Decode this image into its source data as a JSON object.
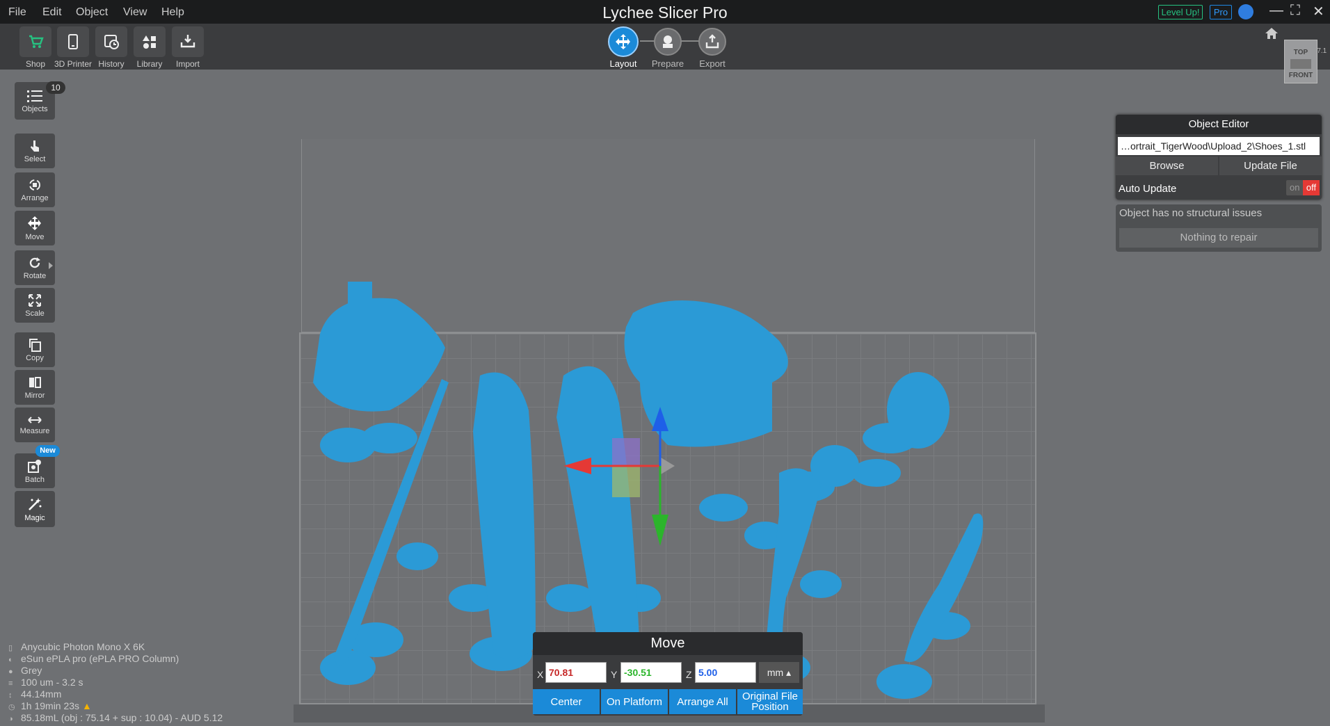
{
  "menu": [
    "File",
    "Edit",
    "Object",
    "View",
    "Help"
  ],
  "app_title": "Lychee Slicer Pro",
  "badges": {
    "level_up": "Level Up!",
    "pro": "Pro"
  },
  "toolbar": {
    "items": [
      "Shop",
      "3D Printer",
      "History",
      "Library",
      "Import"
    ]
  },
  "workflow": {
    "steps": [
      "Layout",
      "Prepare",
      "Export"
    ],
    "active": "Layout"
  },
  "version": "3.7.1",
  "viewcube": {
    "top": "TOP",
    "front": "FRONT"
  },
  "left_tools": {
    "objects": "Objects",
    "object_count": "10",
    "select": "Select",
    "arrange": "Arrange",
    "move": "Move",
    "rotate": "Rotate",
    "scale": "Scale",
    "copy": "Copy",
    "mirror": "Mirror",
    "measure": "Measure",
    "batch": "Batch",
    "batch_badge": "New",
    "magic": "Magic"
  },
  "info": {
    "printer": "Anycubic Photon Mono X 6K",
    "resin": "eSun ePLA pro (ePLA PRO Column)",
    "color": "Grey",
    "layer": "100 um - 3.2 s",
    "height": "44.14mm",
    "time": "1h 19min 23s",
    "volume": "85.18mL (obj : 75.14 + sup : 10.04) - AUD 5.12"
  },
  "object_editor": {
    "title": "Object Editor",
    "file_path": "…ortrait_TigerWood\\Upload_2\\Shoes_1.stl",
    "browse": "Browse",
    "update_file": "Update File",
    "auto_update_label": "Auto Update",
    "toggle_on": "on",
    "toggle_off": "off",
    "status": "Object has no structural issues",
    "repair": "Nothing to repair"
  },
  "move_panel": {
    "title": "Move",
    "x_label": "X",
    "y_label": "Y",
    "z_label": "Z",
    "x": "70.81",
    "y": "-30.51",
    "z": "5.00",
    "unit": "mm ▴",
    "center": "Center",
    "on_platform": "On Platform",
    "arrange_all": "Arrange All",
    "original_position": "Original File Position"
  },
  "colors": {
    "accent": "#1b8ad8",
    "model": "#2b9ad6",
    "magic": "#23b28e",
    "x_axis": "#e53935",
    "y_axis": "#2bb52b",
    "z_axis": "#1e5fe8"
  }
}
